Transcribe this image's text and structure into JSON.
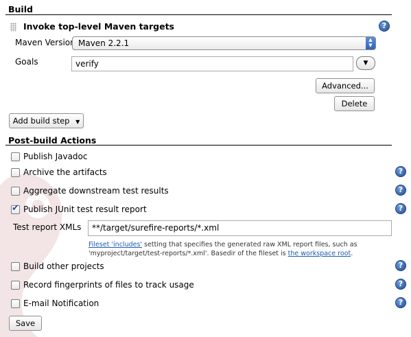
{
  "build": {
    "title": "Build",
    "step_title": "Invoke top-level Maven targets",
    "maven_version_label": "Maven Version",
    "maven_version_value": "Maven 2.2.1",
    "goals_label": "Goals",
    "goals_value": "verify",
    "advanced_label": "Advanced...",
    "delete_label": "Delete",
    "add_step_label": "Add build step",
    "add_step_arrow": "▼"
  },
  "post_build": {
    "title": "Post-build Actions",
    "items": [
      {
        "label": "Publish Javadoc",
        "checked": false
      },
      {
        "label": "Archive the artifacts",
        "checked": false
      },
      {
        "label": "Aggregate downstream test results",
        "checked": false
      },
      {
        "label": "Publish JUnit test result report",
        "checked": true
      }
    ],
    "test_report_label": "Test report XMLs",
    "test_report_value": "**/target/surefire-reports/*.xml",
    "desc": {
      "link1": "Fileset 'includes'",
      "text1": " setting that specifies the generated raw XML report files, such as",
      "text2": "'myproject/target/test-reports/*.xml'. Basedir of the fileset is ",
      "link2": "the workspace root",
      "text3": "."
    },
    "items2": [
      {
        "label": "Build other projects",
        "checked": false
      },
      {
        "label": "Record fingerprints of files to track usage",
        "checked": false
      },
      {
        "label": "E-mail Notification",
        "checked": false
      }
    ]
  },
  "save_label": "Save",
  "help_glyph": "?"
}
